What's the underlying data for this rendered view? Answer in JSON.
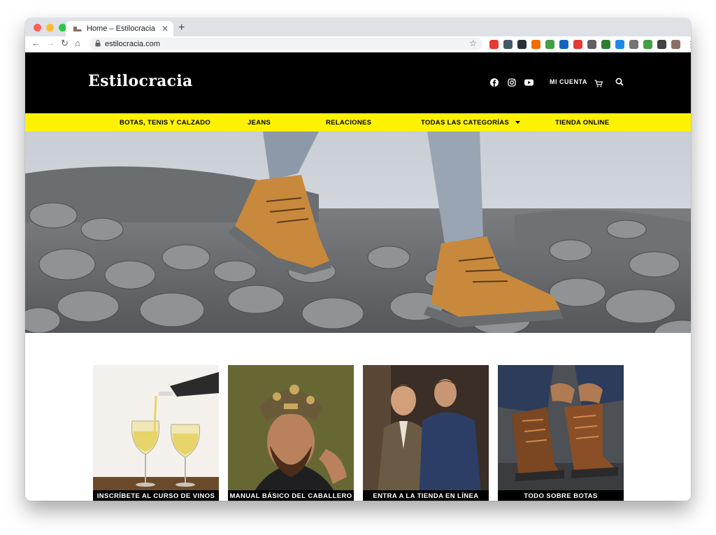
{
  "browser": {
    "tab_title": "Home – Estilocracia",
    "url": "estilocracia.com",
    "extensions": [
      "#e53935",
      "#455a64",
      "#263238",
      "#ef6c00",
      "#43a047",
      "#1565c0",
      "#e53935",
      "#616161",
      "#2e7d32",
      "#1e88e5",
      "#757575",
      "#43a047",
      "#424242",
      "#8d6e63"
    ]
  },
  "header": {
    "logo": "Estilocracia",
    "account_label": "MI CUENTA"
  },
  "nav": {
    "items": [
      "BOTAS, TENIS Y CALZADO",
      "JEANS",
      "RELACIONES",
      "TODAS LAS CATEGORÍAS",
      "TIENDA ONLINE"
    ]
  },
  "cards": [
    {
      "label": "INSCRÍBETE AL CURSO DE VINOS"
    },
    {
      "label": "MANUAL BÁSICO DEL CABALLERO"
    },
    {
      "label": "ENTRA A LA TIENDA EN LÍNEA"
    },
    {
      "label": "TODO SOBRE BOTAS"
    }
  ],
  "colors": {
    "header_bg": "#000000",
    "nav_bg": "#fff200",
    "card_label_bg": "#000000"
  }
}
